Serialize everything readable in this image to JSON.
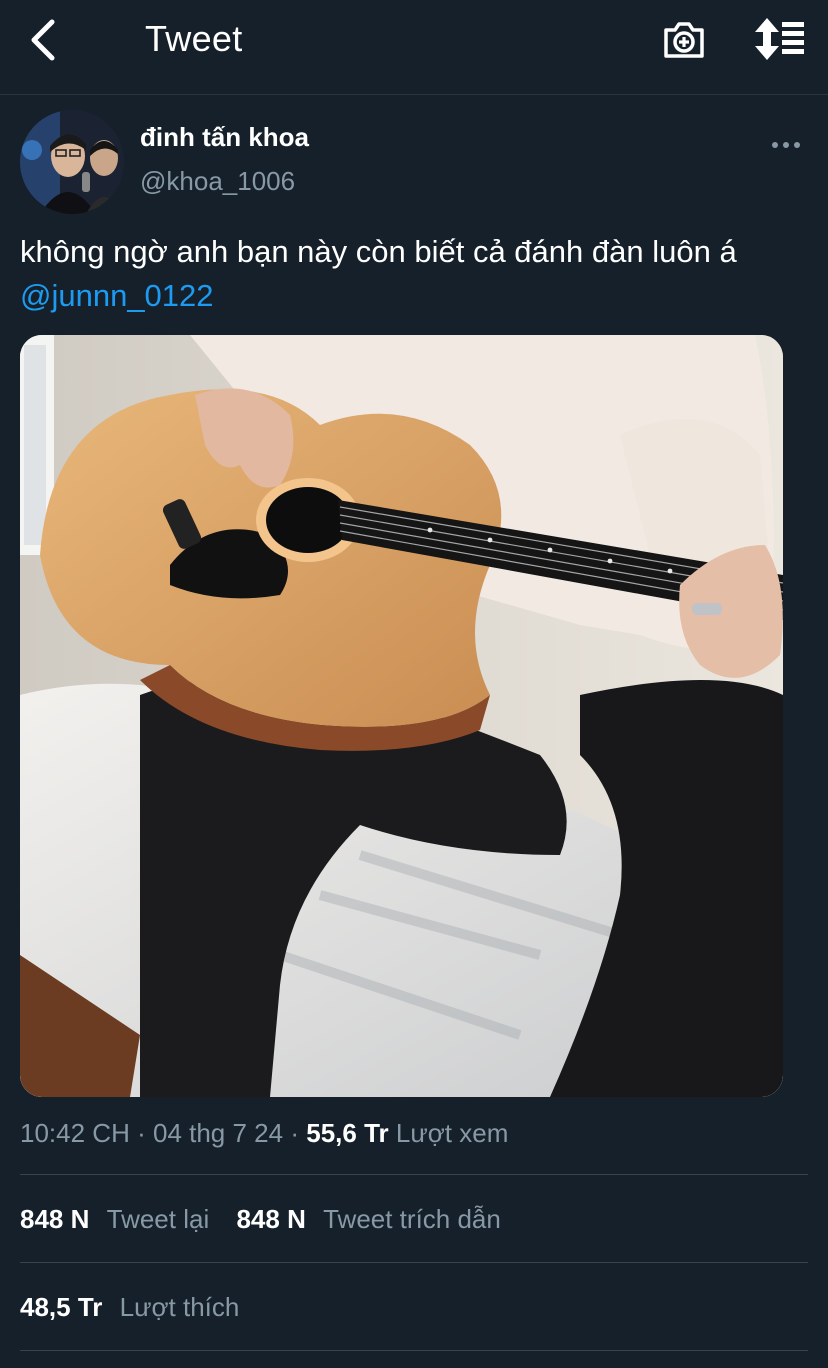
{
  "header": {
    "title": "Tweet",
    "back_icon": "chevron-left-icon",
    "camera_icon": "camera-plus-icon",
    "sort_icon": "sort-list-icon"
  },
  "tweet": {
    "display_name": "đinh tấn khoa",
    "handle": "@khoa_1006",
    "text": "không ngờ anh bạn này còn biết cả đánh đàn luôn á ",
    "mention": "@junnn_0122",
    "time": "10:42 CH",
    "date": "04 thg 7 24",
    "separator": "·",
    "views_count": "55,6 Tr",
    "views_label": "Lượt xem"
  },
  "stats": {
    "retweets_count": "848 N",
    "retweets_label": "Tweet lại",
    "quotes_count": "848 N",
    "quotes_label": "Tweet trích dẫn",
    "likes_count": "48,5 Tr",
    "likes_label": "Lượt thích"
  },
  "colors": {
    "background": "#15202b",
    "accent": "#1d9bf0",
    "secondary_text": "#8899a6",
    "divider": "#38444d"
  }
}
